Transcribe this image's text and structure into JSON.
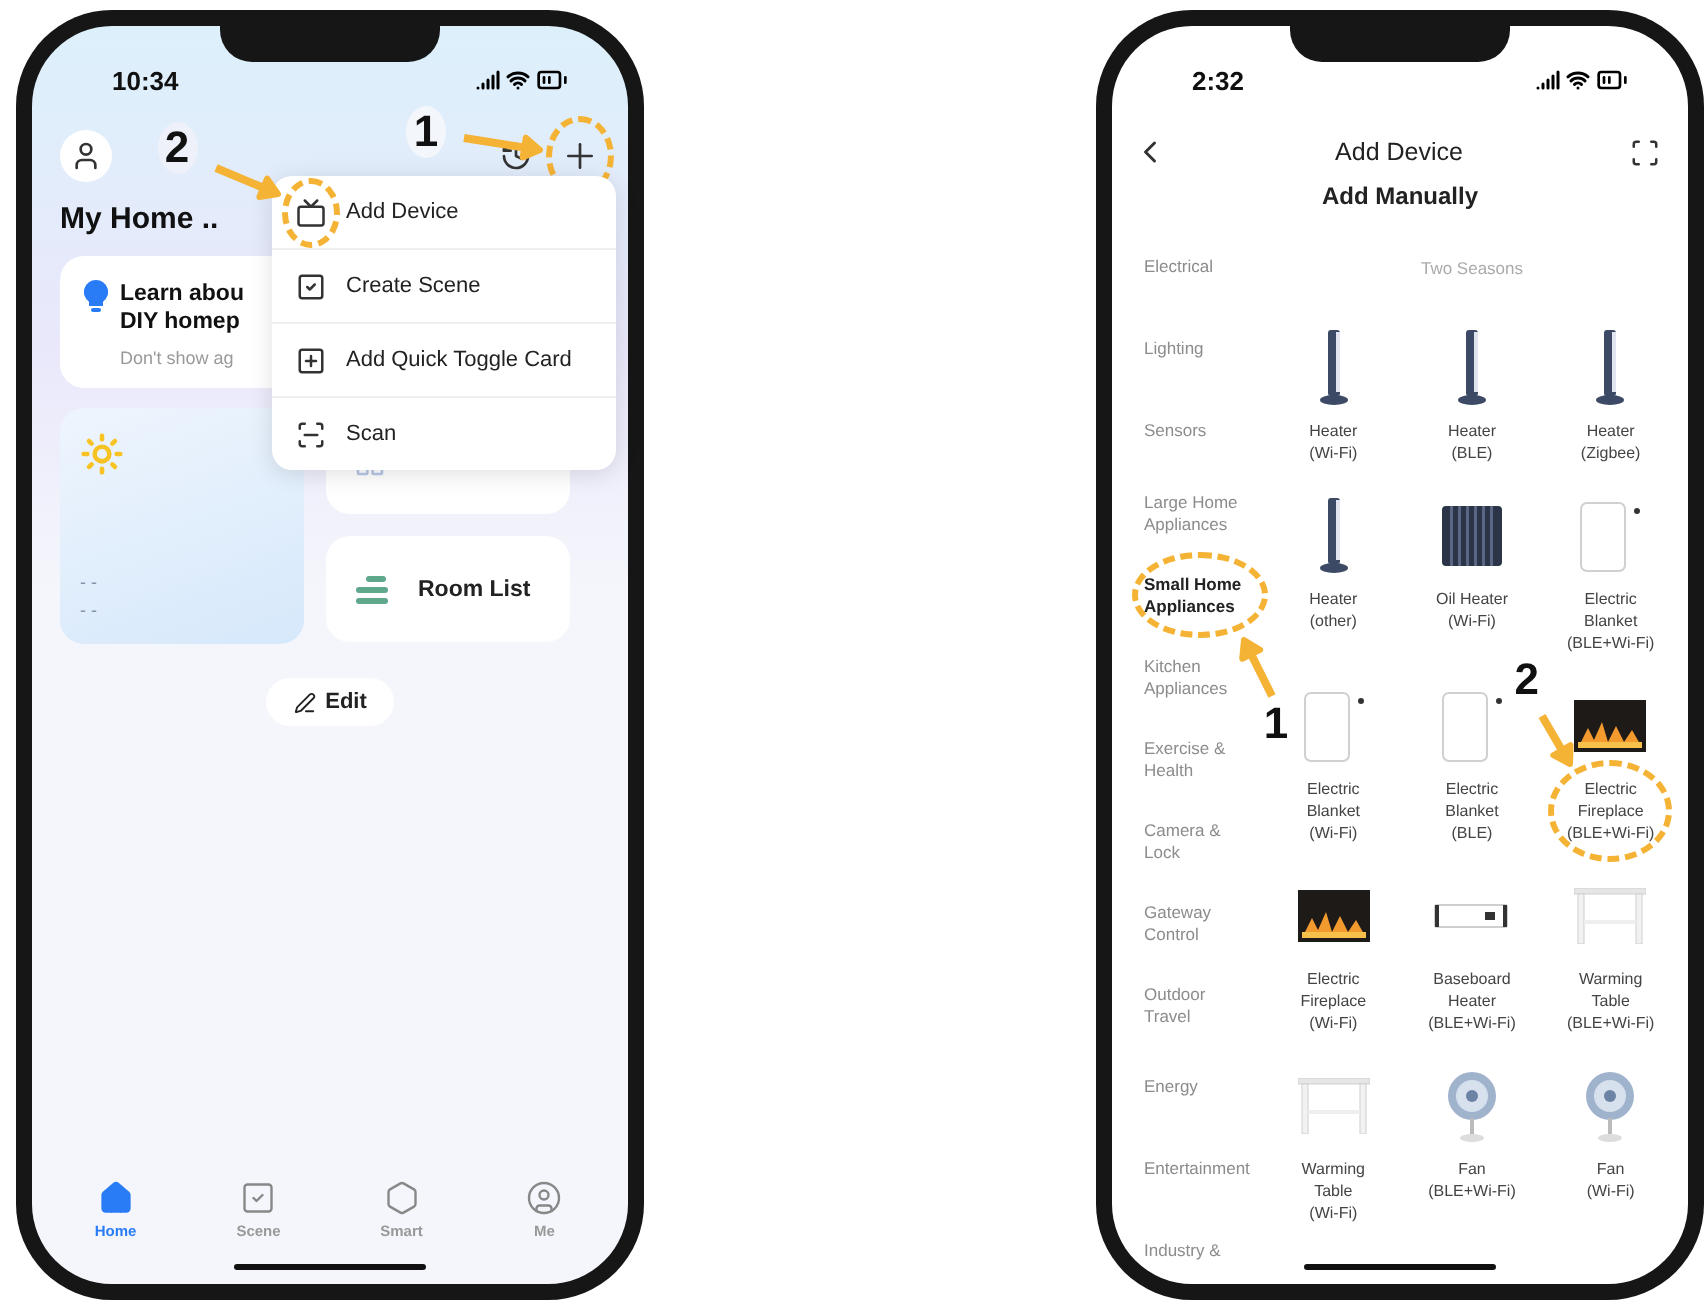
{
  "left_phone": {
    "status_time": "10:34",
    "add_button": {
      "highlighted": true,
      "step": "1"
    },
    "title": "My Home ..",
    "tip_card": {
      "title_lines": [
        "Learn abou",
        "DIY homep"
      ],
      "subtitle": "Don't show ag"
    },
    "weather": {
      "readings": [
        "- -",
        "- -"
      ]
    },
    "room_list": {
      "label": "Room List"
    },
    "edit_button": {
      "label": "Edit"
    },
    "menu": {
      "items": [
        {
          "kind": "device",
          "label": "Add Device",
          "highlighted": true,
          "step": "2"
        },
        {
          "kind": "scene",
          "label": "Create Scene",
          "highlighted": false
        },
        {
          "kind": "toggle-card",
          "label": "Add Quick Toggle Card",
          "highlighted": false
        },
        {
          "kind": "scan",
          "label": "Scan",
          "highlighted": false
        }
      ]
    },
    "tabs": [
      {
        "kind": "home",
        "label": "Home",
        "selected": true
      },
      {
        "kind": "scene",
        "label": "Scene",
        "selected": false
      },
      {
        "kind": "smart",
        "label": "Smart",
        "selected": false
      },
      {
        "kind": "me",
        "label": "Me",
        "selected": false
      }
    ]
  },
  "right_phone": {
    "status_time": "2:32",
    "title": "Add Device",
    "subtitle": "Add Manually",
    "categories": [
      {
        "label": "Electrical",
        "selected": false,
        "highlighted": false
      },
      {
        "label": "Lighting",
        "selected": false,
        "highlighted": false
      },
      {
        "label": "Sensors",
        "selected": false,
        "highlighted": false
      },
      {
        "label": "Large Home Appliances",
        "selected": false,
        "highlighted": false
      },
      {
        "label": "Small Home Appliances",
        "selected": true,
        "highlighted": true,
        "step": "1"
      },
      {
        "label": "Kitchen Appliances",
        "selected": false,
        "highlighted": false
      },
      {
        "label": "Exercise & Health",
        "selected": false,
        "highlighted": false
      },
      {
        "label": "Camera & Lock",
        "selected": false,
        "highlighted": false
      },
      {
        "label": "Gateway Control",
        "selected": false,
        "highlighted": false
      },
      {
        "label": "Outdoor Travel",
        "selected": false,
        "highlighted": false
      },
      {
        "label": "Energy",
        "selected": false,
        "highlighted": false
      },
      {
        "label": "Entertainment",
        "selected": false,
        "highlighted": false
      },
      {
        "label": "Industry &",
        "selected": false,
        "highlighted": false
      }
    ],
    "section": "Two Seasons",
    "devices": [
      {
        "kind": "heater",
        "name": "Heater",
        "protocol": "(Wi-Fi)",
        "highlighted": false
      },
      {
        "kind": "heater",
        "name": "Heater",
        "protocol": "(BLE)",
        "highlighted": false
      },
      {
        "kind": "heater",
        "name": "Heater",
        "protocol": "(Zigbee)",
        "highlighted": false
      },
      {
        "kind": "heater",
        "name": "Heater",
        "protocol": "(other)",
        "highlighted": false
      },
      {
        "kind": "oil-heater",
        "name": "Oil Heater",
        "protocol": "(Wi-Fi)",
        "highlighted": false
      },
      {
        "kind": "blanket",
        "name": "Electric Blanket",
        "protocol": "(BLE+Wi-Fi)",
        "highlighted": false
      },
      {
        "kind": "blanket",
        "name": "Electric Blanket",
        "protocol": "(Wi-Fi)",
        "highlighted": false
      },
      {
        "kind": "blanket",
        "name": "Electric Blanket",
        "protocol": "(BLE)",
        "highlighted": false
      },
      {
        "kind": "fireplace",
        "name": "Electric Fireplace",
        "protocol": "(BLE+Wi-Fi)",
        "highlighted": true,
        "step": "2"
      },
      {
        "kind": "fireplace",
        "name": "Electric Fireplace",
        "protocol": "(Wi-Fi)",
        "highlighted": false
      },
      {
        "kind": "baseboard",
        "name": "Baseboard Heater",
        "protocol": "(BLE+Wi-Fi)",
        "highlighted": false
      },
      {
        "kind": "table",
        "name": "Warming Table",
        "protocol": "(BLE+Wi-Fi)",
        "highlighted": false
      },
      {
        "kind": "table",
        "name": "Warming Table",
        "protocol": "(Wi-Fi)",
        "highlighted": false
      },
      {
        "kind": "fan",
        "name": "Fan",
        "protocol": "(BLE+Wi-Fi)",
        "highlighted": false
      },
      {
        "kind": "fan",
        "name": "Fan",
        "protocol": "(Wi-Fi)",
        "highlighted": false
      }
    ]
  }
}
